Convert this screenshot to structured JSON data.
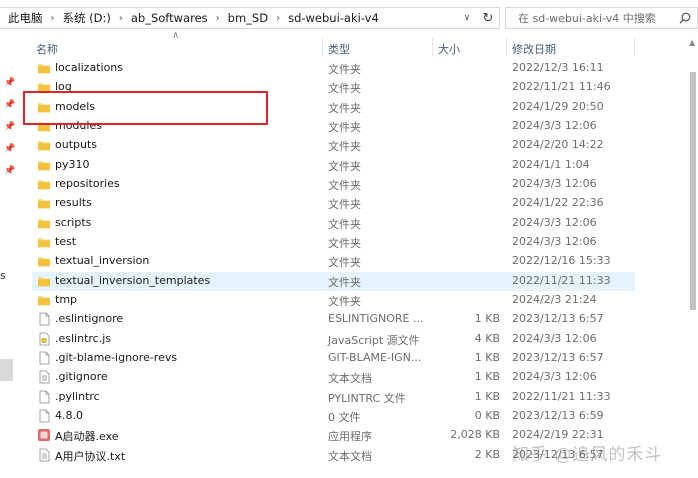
{
  "address_bar": {
    "breadcrumbs": [
      "此电脑",
      "系统 (D:)",
      "ab_Softwares",
      "bm_SD",
      "sd-webui-aki-v4"
    ]
  },
  "search": {
    "placeholder": "在 sd-webui-aki-v4 中搜索"
  },
  "columns": {
    "name": "名称",
    "type": "类型",
    "size": "大小",
    "date": "修改日期"
  },
  "nav_pane": {
    "letter": "s"
  },
  "files": [
    {
      "name": "localizations",
      "type": "文件夹",
      "size": "",
      "date": "2022/12/3 16:11",
      "icon": "folder-icon"
    },
    {
      "name": "log",
      "type": "文件夹",
      "size": "",
      "date": "2022/11/21 11:46",
      "icon": "folder-icon"
    },
    {
      "name": "models",
      "type": "文件夹",
      "size": "",
      "date": "2024/1/29 20:50",
      "icon": "folder-icon"
    },
    {
      "name": "modules",
      "type": "文件夹",
      "size": "",
      "date": "2024/3/3 12:06",
      "icon": "folder-icon"
    },
    {
      "name": "outputs",
      "type": "文件夹",
      "size": "",
      "date": "2024/2/20 14:22",
      "icon": "folder-icon"
    },
    {
      "name": "py310",
      "type": "文件夹",
      "size": "",
      "date": "2024/1/1 1:04",
      "icon": "folder-icon"
    },
    {
      "name": "repositories",
      "type": "文件夹",
      "size": "",
      "date": "2024/3/3 12:06",
      "icon": "folder-icon"
    },
    {
      "name": "results",
      "type": "文件夹",
      "size": "",
      "date": "2024/1/22 22:36",
      "icon": "folder-icon"
    },
    {
      "name": "scripts",
      "type": "文件夹",
      "size": "",
      "date": "2024/3/3 12:06",
      "icon": "folder-icon"
    },
    {
      "name": "test",
      "type": "文件夹",
      "size": "",
      "date": "2024/3/3 12:06",
      "icon": "folder-icon"
    },
    {
      "name": "textual_inversion",
      "type": "文件夹",
      "size": "",
      "date": "2022/12/16 15:33",
      "icon": "folder-icon"
    },
    {
      "name": "textual_inversion_templates",
      "type": "文件夹",
      "size": "",
      "date": "2022/11/21 11:33",
      "icon": "folder-icon"
    },
    {
      "name": "tmp",
      "type": "文件夹",
      "size": "",
      "date": "2024/2/3 21:24",
      "icon": "folder-icon"
    },
    {
      "name": ".eslintignore",
      "type": "ESLINTIGNORE ...",
      "size": "1 KB",
      "date": "2023/12/13 6:57",
      "icon": "file-icon"
    },
    {
      "name": ".eslintrc.js",
      "type": "JavaScript 源文件",
      "size": "4 KB",
      "date": "2024/3/3 12:06",
      "icon": "js-file-icon"
    },
    {
      "name": ".git-blame-ignore-revs",
      "type": "GIT-BLAME-IGN...",
      "size": "1 KB",
      "date": "2023/12/13 6:57",
      "icon": "file-icon"
    },
    {
      "name": ".gitignore",
      "type": "文本文档",
      "size": "1 KB",
      "date": "2024/3/3 12:06",
      "icon": "text-file-icon"
    },
    {
      "name": ".pylintrc",
      "type": "PYLINTRC 文件",
      "size": "1 KB",
      "date": "2022/11/21 11:33",
      "icon": "file-icon"
    },
    {
      "name": "4.8.0",
      "type": "0 文件",
      "size": "0 KB",
      "date": "2023/12/13 6:59",
      "icon": "file-icon"
    },
    {
      "name": "A启动器.exe",
      "type": "应用程序",
      "size": "2,028 KB",
      "date": "2024/2/19 22:31",
      "icon": "exe-icon"
    },
    {
      "name": "A用户协议.txt",
      "type": "文本文档",
      "size": "2 KB",
      "date": "2023/12/13 6:57",
      "icon": "text-file-icon"
    }
  ],
  "watermark": "知乎 @追风的禾斗"
}
